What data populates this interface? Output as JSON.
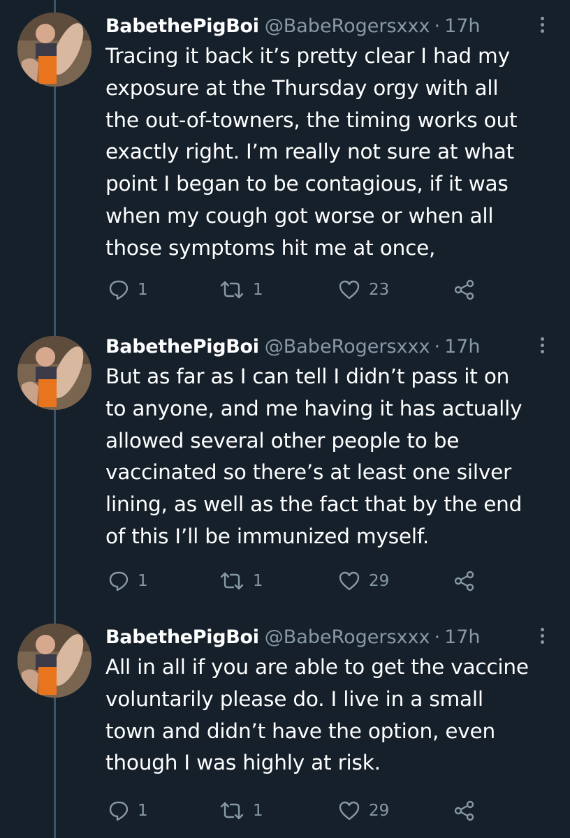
{
  "tweets": [
    {
      "name": "BabethePigBoi",
      "handle": "@BabeRogersxxx",
      "separator": "·",
      "time": "17h",
      "lines": [
        "Tracing it back it’s pretty clear I had my",
        "exposure at the Thursday orgy with all",
        "the out-of-towners, the timing works out",
        "exactly right. I’m really not sure at what",
        "point I began to be contagious, if it was",
        "when my cough got worse or when all",
        "those symptoms hit me at once,"
      ],
      "replies": "1",
      "retweets": "1",
      "likes": "23"
    },
    {
      "name": "BabethePigBoi",
      "handle": "@BabeRogersxxx",
      "separator": "·",
      "time": "17h",
      "lines": [
        "But as far as I can tell I didn’t pass it on",
        "to anyone, and me having it has actually",
        "allowed several other people to be",
        "vaccinated so there’s at least one silver",
        "lining, as well as the fact that by the end",
        "of this I’ll be immunized myself."
      ],
      "replies": "1",
      "retweets": "1",
      "likes": "29"
    },
    {
      "name": "BabethePigBoi",
      "handle": "@BabeRogersxxx",
      "separator": "·",
      "time": "17h",
      "lines": [
        "All in all if you are able to get the vaccine",
        "voluntarily please do. I live in a small",
        "town and didn’t have the option, even",
        "though I was highly at risk."
      ],
      "replies": "1",
      "retweets": "1",
      "likes": "29"
    }
  ],
  "icons": {
    "reply": "reply-icon",
    "retweet": "retweet-icon",
    "like": "heart-icon",
    "share": "share-icon",
    "more": "more-vertical-icon"
  },
  "colors": {
    "background": "#15202b",
    "text": "#ffffff",
    "secondary": "#8899a6",
    "thread_line": "#3d5466"
  }
}
